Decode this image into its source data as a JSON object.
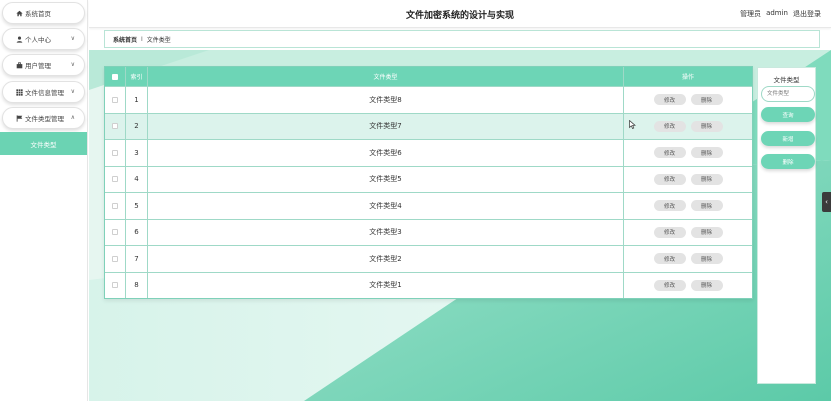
{
  "app": {
    "title": "文件加密系统的设计与实现"
  },
  "header": {
    "user_role": "管理员",
    "username": "admin",
    "logout_label": "退出登录"
  },
  "sidebar": {
    "items": [
      {
        "label": "系统首页",
        "icon": "home-icon",
        "has_caret": false
      },
      {
        "label": "个人中心",
        "icon": "user-icon",
        "has_caret": true
      },
      {
        "label": "用户管理",
        "icon": "briefcase-icon",
        "has_caret": true
      },
      {
        "label": "文件信息管理",
        "icon": "grid-icon",
        "has_caret": true
      },
      {
        "label": "文件类型管理",
        "icon": "flag-icon",
        "has_caret": true,
        "expanded": true
      }
    ],
    "active_subitem": "文件类型"
  },
  "breadcrumb": {
    "home": "系统首页",
    "separator": "Ⅰ",
    "current": "文件类型"
  },
  "table": {
    "columns": [
      "索引",
      "文件类型",
      "操作"
    ],
    "rows": [
      {
        "index": "1",
        "name": "文件类型8"
      },
      {
        "index": "2",
        "name": "文件类型7"
      },
      {
        "index": "3",
        "name": "文件类型6"
      },
      {
        "index": "4",
        "name": "文件类型5"
      },
      {
        "index": "5",
        "name": "文件类型4"
      },
      {
        "index": "6",
        "name": "文件类型3"
      },
      {
        "index": "7",
        "name": "文件类型2"
      },
      {
        "index": "8",
        "name": "文件类型1"
      }
    ],
    "edit_label": "修改",
    "delete_label": "删除"
  },
  "search_panel": {
    "label": "文件类型",
    "placeholder": "文件类型",
    "search_label": "查询",
    "add_label": "新增",
    "delete_label": "删除"
  },
  "colors": {
    "accent": "#6dd5b6",
    "accent_dark": "#4fbf9d",
    "background": "#e9f7f2"
  }
}
